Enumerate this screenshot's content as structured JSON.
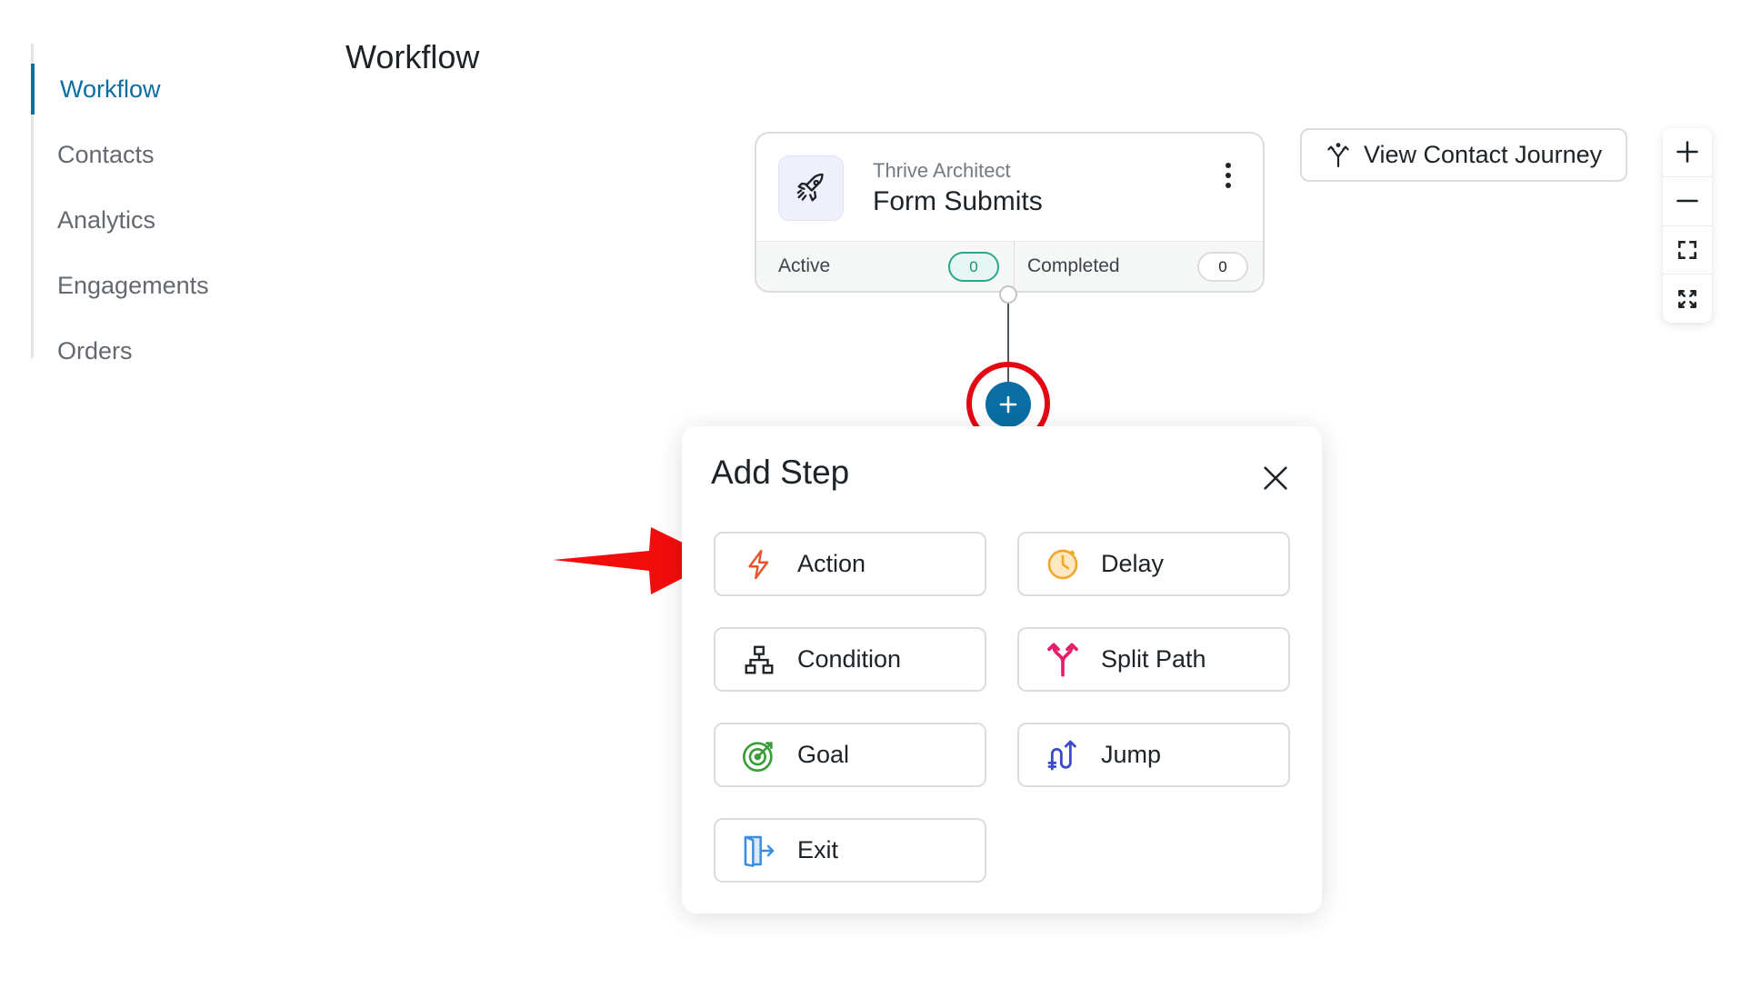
{
  "sidebar": {
    "items": [
      {
        "label": "Workflow",
        "active": true
      },
      {
        "label": "Contacts"
      },
      {
        "label": "Analytics"
      },
      {
        "label": "Engagements"
      },
      {
        "label": "Orders"
      }
    ]
  },
  "page": {
    "title": "Workflow"
  },
  "trigger": {
    "source": "Thrive Architect",
    "name": "Form Submits",
    "icon": "rocket-icon",
    "active_label": "Active",
    "active_count": "0",
    "completed_label": "Completed",
    "completed_count": "0"
  },
  "toolbar": {
    "journey_label": "View Contact Journey",
    "journey_icon": "branch-icon"
  },
  "zoom": {
    "controls": [
      "zoom-in-icon",
      "zoom-out-icon",
      "fit-view-icon",
      "fullscreen-icon"
    ]
  },
  "add_step": {
    "title": "Add Step",
    "options": [
      {
        "label": "Action",
        "icon": "lightning-icon",
        "color": "#e8552d"
      },
      {
        "label": "Delay",
        "icon": "clock-icon",
        "color": "#f0a92e"
      },
      {
        "label": "Condition",
        "icon": "hierarchy-icon",
        "color": "#1d2327"
      },
      {
        "label": "Split Path",
        "icon": "split-arrows-icon",
        "color": "#e61e6b"
      },
      {
        "label": "Goal",
        "icon": "target-icon",
        "color": "#3a9d3a"
      },
      {
        "label": "Jump",
        "icon": "jump-icon",
        "color": "#3b4bc9"
      },
      {
        "label": "Exit",
        "icon": "exit-door-icon",
        "color": "#3d8de0"
      }
    ]
  },
  "colors": {
    "accent": "#0a6ea3",
    "highlight": "#e30613"
  }
}
